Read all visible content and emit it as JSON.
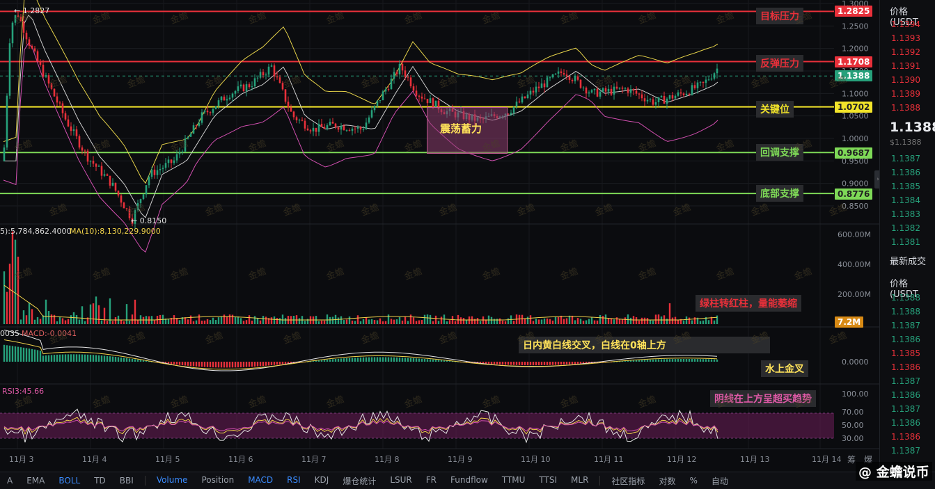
{
  "price_axis": {
    "labels": [
      "1.3000",
      "1.2500",
      "1.2000",
      "1.1500",
      "1.1000",
      "1.0500",
      "1.0000",
      "0.9500",
      "0.9000",
      "0.8500"
    ],
    "volume_labels": [
      "600.00M",
      "400.00M",
      "200.00M"
    ],
    "macd_label": "0.0000",
    "rsi_labels": [
      "100.00",
      "70.00",
      "50.00",
      "30.00"
    ]
  },
  "time_axis": [
    "11月 3",
    "11月 4",
    "11月 5",
    "11月 6",
    "11月 7",
    "11月 8",
    "11月 9",
    "11月 10",
    "11月 11",
    "11月 12",
    "11月 13",
    "11月 14"
  ],
  "markers": {
    "high": "← 1.2827",
    "low": "← 0.8150"
  },
  "levels": [
    {
      "name": "目标压力",
      "value": "1.2825",
      "color": "#e8303a"
    },
    {
      "name": "反弹压力",
      "value": "1.1708",
      "color": "#e8303a"
    },
    {
      "name": "current",
      "value": "1.1388",
      "color": "#26a17b"
    },
    {
      "name": "关键位",
      "value": "1.0702",
      "color": "#f2e42a"
    },
    {
      "name": "回调支撑",
      "value": "0.9687",
      "color": "#7ed957"
    },
    {
      "name": "底部支撑",
      "value": "0.8776",
      "color": "#7ed957"
    }
  ],
  "annotations": {
    "box": "震荡蓄力",
    "volume_note": "绿柱转红柱，量能萎缩",
    "macd_note": "日内黄白线交叉，白线在0轴上方",
    "macd_note2": "水上金叉",
    "rsi_note": "阴线在上方呈超买趋势"
  },
  "indicator_headers": {
    "volume": "5):5,784,862.4000",
    "volume_ma10": "MA(10):8,130,229.9000",
    "volume_tag": "7.2M",
    "macd_left": "0035",
    "macd": "MACD:-0.0041",
    "rsi": "RSI3:45.66"
  },
  "bottom_toolbar": {
    "left_items": [
      "A",
      "EMA",
      "BOLL",
      "TD",
      "BBI"
    ],
    "right_items": [
      "Volume",
      "Position",
      "MACD",
      "RSI",
      "KDJ",
      "爆仓统计",
      "LSUR",
      "FR",
      "Fundflow",
      "TTMU",
      "TTSI",
      "MLR"
    ],
    "active": [
      "BOLL",
      "Volume",
      "MACD",
      "RSI"
    ],
    "community": "社区指标",
    "extra": [
      "对数",
      "%",
      "自动"
    ]
  },
  "right_panel": {
    "header": "价格(USDT",
    "asks": [
      "1.1394",
      "1.1393",
      "1.1392",
      "1.1391",
      "1.1390",
      "1.1389",
      "1.1388"
    ],
    "last_price": "1.1388",
    "last_price_usd": "$1.1388",
    "bids": [
      "1.1387",
      "1.1386",
      "1.1385",
      "1.1384",
      "1.1383",
      "1.1382",
      "1.1381"
    ],
    "trades_title": "最新成交",
    "trades_header": "价格(USDT",
    "trades": [
      {
        "p": "1.1388",
        "c": "#26a17b"
      },
      {
        "p": "1.1388",
        "c": "#26a17b"
      },
      {
        "p": "1.1387",
        "c": "#26a17b"
      },
      {
        "p": "1.1386",
        "c": "#26a17b"
      },
      {
        "p": "1.1385",
        "c": "#e8303a"
      },
      {
        "p": "1.1386",
        "c": "#e8303a"
      },
      {
        "p": "1.1387",
        "c": "#26a17b"
      },
      {
        "p": "1.1386",
        "c": "#26a17b"
      },
      {
        "p": "1.1387",
        "c": "#26a17b"
      },
      {
        "p": "1.1386",
        "c": "#26a17b"
      },
      {
        "p": "1.1386",
        "c": "#e8303a"
      },
      {
        "p": "1.1387",
        "c": "#26a17b"
      }
    ]
  },
  "side_labels": [
    "筹",
    "爆"
  ],
  "brand": "@ 金蟾说币",
  "watermark": "金蟾",
  "colors": {
    "up": "#26a17b",
    "down": "#e8303a",
    "yellow": "#f2e42a",
    "green": "#7ed957",
    "boll_mid": "#cfcfcf",
    "boll_lower": "#d24fb0"
  }
}
